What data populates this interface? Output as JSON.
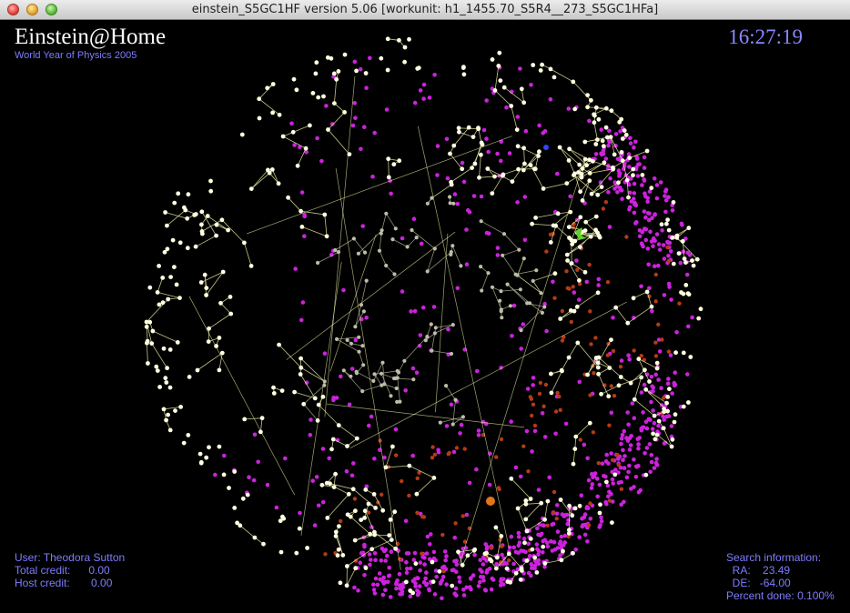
{
  "window": {
    "title": "einstein_S5GC1HF version 5.06 [workunit: h1_1455.70_S5R4__273_S5GC1HFa]"
  },
  "branding": {
    "title": "Einstein@Home",
    "subtitle": "World Year of Physics 2005"
  },
  "clock": "16:27:19",
  "user_info": {
    "user_label": "User:",
    "user_name": "Theodora Sutton",
    "total_credit_label": "Total credit:",
    "total_credit": "0.00",
    "host_credit_label": "Host credit:",
    "host_credit": "0.00"
  },
  "search_info": {
    "heading": "Search information:",
    "ra_label": "RA:",
    "ra": "23.49",
    "de_label": "DE:",
    "de": "-64.00",
    "percent_label": "Percent done:",
    "percent": "0.100%"
  },
  "colors": {
    "constellation_stars": "#ffffe0",
    "constellation_lines": "#e8e8a0",
    "pulsars": "#cc22dd",
    "supernova_remnants": "#b53a14",
    "text_accent": "#7f7cff"
  }
}
